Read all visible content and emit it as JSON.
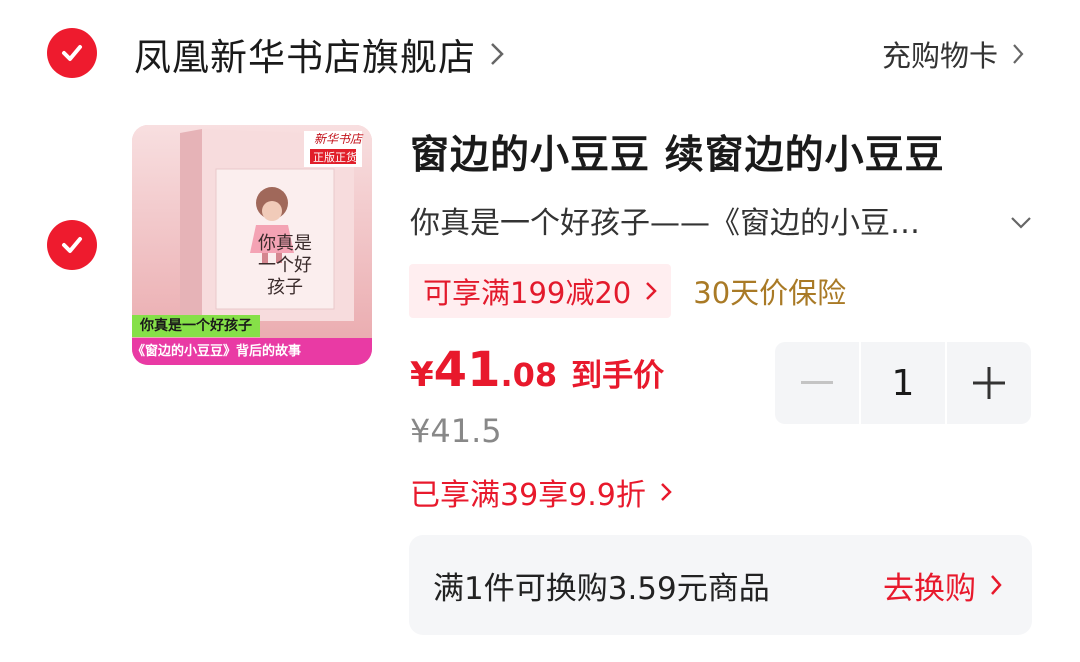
{
  "shop": {
    "name": "凤凰新华书店旗舰店",
    "coupon_link": "充购物卡"
  },
  "item": {
    "title": "窗边的小豆豆 续窗边的小豆豆",
    "spec": "你真是一个好孩子——《窗边的小豆…",
    "promo": "可享满199减20",
    "insurance": "30天价保险",
    "price_symbol": "¥",
    "price_int": "41",
    "price_dec": ".08",
    "price_tag": "到手价",
    "original_price": "¥41.5",
    "discount": "已享满39享9.9折",
    "quantity": "1",
    "thumbnail": {
      "badge_top": "新华书店",
      "badge_sub": "正版正货",
      "cover_title": "你真是一个好孩子",
      "banner_line1": "你真是一个好孩子",
      "banner_line2": "《窗边的小豆豆》背后的故事"
    }
  },
  "exchange": {
    "text": "满1件可换购3.59元商品",
    "link": "去换购"
  },
  "colors": {
    "accent_red": "#e8192c",
    "insurance_gold": "#a97a26",
    "promo_bg": "#ffeef0"
  }
}
